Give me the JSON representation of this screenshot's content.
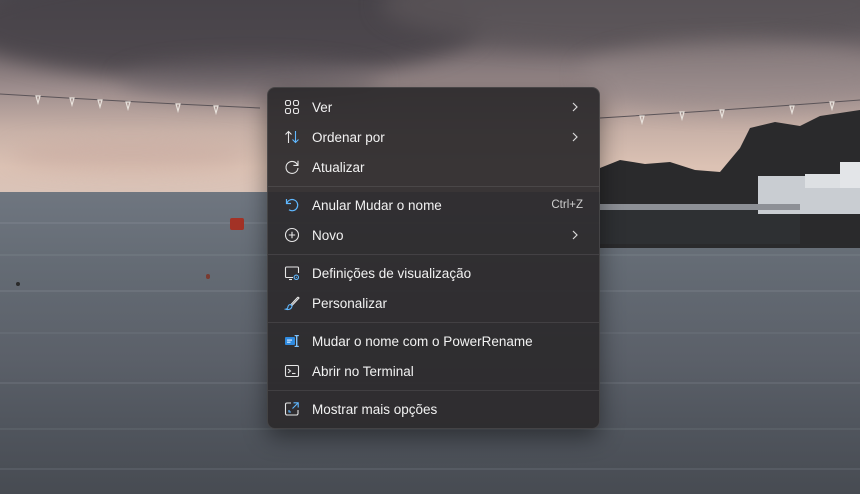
{
  "context_menu": {
    "groups": [
      {
        "items": [
          {
            "label": "Ver",
            "icon": "grid-icon",
            "submenu": true
          },
          {
            "label": "Ordenar por",
            "icon": "sort-arrows-icon",
            "submenu": true
          },
          {
            "label": "Atualizar",
            "icon": "refresh-icon"
          }
        ]
      },
      {
        "items": [
          {
            "label": "Anular Mudar o nome",
            "icon": "undo-icon",
            "shortcut": "Ctrl+Z"
          },
          {
            "label": "Novo",
            "icon": "plus-circle-icon",
            "submenu": true
          }
        ]
      },
      {
        "items": [
          {
            "label": "Definições de visualização",
            "icon": "display-settings-icon"
          },
          {
            "label": "Personalizar",
            "icon": "brush-icon"
          }
        ]
      },
      {
        "items": [
          {
            "label": "Mudar o nome com o PowerRename",
            "icon": "powerrename-icon"
          },
          {
            "label": "Abrir no Terminal",
            "icon": "terminal-icon"
          }
        ]
      },
      {
        "items": [
          {
            "label": "Mostrar mais opções",
            "icon": "expand-icon"
          }
        ]
      }
    ]
  },
  "colors": {
    "menu_background": "#2c2a2c",
    "text": "#f2f2f2",
    "accent_blue": "#60b8ff"
  }
}
